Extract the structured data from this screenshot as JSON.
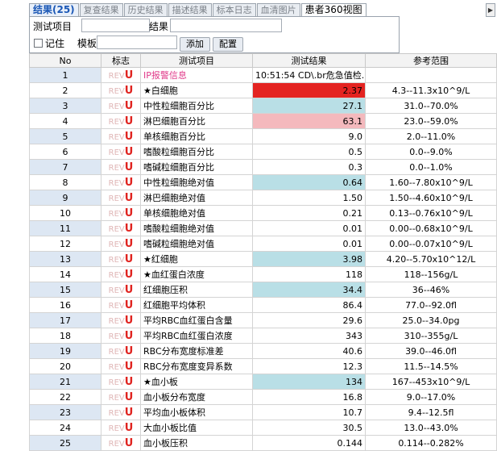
{
  "tabs": [
    {
      "label": "结果(25)",
      "active": true
    },
    {
      "label": "复查结果",
      "active": false
    },
    {
      "label": "历史结果",
      "active": false
    },
    {
      "label": "描述结果",
      "active": false
    },
    {
      "label": "标本日志",
      "active": false
    },
    {
      "label": "血清图片",
      "active": false
    },
    {
      "label": "患者360视图",
      "active": false
    }
  ],
  "filter": {
    "test_item_label": "测试项目",
    "result_label": "结果",
    "remember_label": "记住",
    "template_label": "模板",
    "add_button": "添加",
    "config_button": "配置"
  },
  "table": {
    "headers": [
      "No",
      "标志",
      "测试项目",
      "测试结果",
      "参考范围"
    ],
    "flag_rev": "REV",
    "flag_u": "U",
    "rows": [
      {
        "no": "1",
        "name": "IP报警信息",
        "result": "10:51:54 CD\\.br危急值检...",
        "ref": "",
        "hl": ""
      },
      {
        "no": "2",
        "name": "★白细胞",
        "result": "2.37",
        "ref": "4.3--11.3x10^9/L",
        "hl": "red"
      },
      {
        "no": "3",
        "name": "中性粒细胞百分比",
        "result": "27.1",
        "ref": "31.0--70.0%",
        "hl": "blue"
      },
      {
        "no": "4",
        "name": "淋巴细胞百分比",
        "result": "63.1",
        "ref": "23.0--59.0%",
        "hl": "pink"
      },
      {
        "no": "5",
        "name": "单核细胞百分比",
        "result": "9.0",
        "ref": "2.0--11.0%",
        "hl": ""
      },
      {
        "no": "6",
        "name": "嗜酸粒细胞百分比",
        "result": "0.5",
        "ref": "0.0--9.0%",
        "hl": ""
      },
      {
        "no": "7",
        "name": "嗜碱粒细胞百分比",
        "result": "0.3",
        "ref": "0.0--1.0%",
        "hl": ""
      },
      {
        "no": "8",
        "name": "中性粒细胞绝对值",
        "result": "0.64",
        "ref": "1.60--7.80x10^9/L",
        "hl": "blue"
      },
      {
        "no": "9",
        "name": "淋巴细胞绝对值",
        "result": "1.50",
        "ref": "1.50--4.60x10^9/L",
        "hl": ""
      },
      {
        "no": "10",
        "name": "单核细胞绝对值",
        "result": "0.21",
        "ref": "0.13--0.76x10^9/L",
        "hl": ""
      },
      {
        "no": "11",
        "name": "嗜酸粒细胞绝对值",
        "result": "0.01",
        "ref": "0.00--0.68x10^9/L",
        "hl": ""
      },
      {
        "no": "12",
        "name": "嗜碱粒细胞绝对值",
        "result": "0.01",
        "ref": "0.00--0.07x10^9/L",
        "hl": ""
      },
      {
        "no": "13",
        "name": "★红细胞",
        "result": "3.98",
        "ref": "4.20--5.70x10^12/L",
        "hl": "blue"
      },
      {
        "no": "14",
        "name": "★血红蛋白浓度",
        "result": "118",
        "ref": "118--156g/L",
        "hl": ""
      },
      {
        "no": "15",
        "name": "红细胞压积",
        "result": "34.4",
        "ref": "36--46%",
        "hl": "blue"
      },
      {
        "no": "16",
        "name": "红细胞平均体积",
        "result": "86.4",
        "ref": "77.0--92.0fl",
        "hl": ""
      },
      {
        "no": "17",
        "name": "平均RBC血红蛋白含量",
        "result": "29.6",
        "ref": "25.0--34.0pg",
        "hl": ""
      },
      {
        "no": "18",
        "name": "平均RBC血红蛋白浓度",
        "result": "343",
        "ref": "310--355g/L",
        "hl": ""
      },
      {
        "no": "19",
        "name": "RBC分布宽度标准差",
        "result": "40.6",
        "ref": "39.0--46.0fl",
        "hl": ""
      },
      {
        "no": "20",
        "name": "RBC分布宽度变异系数",
        "result": "12.3",
        "ref": "11.5--14.5%",
        "hl": ""
      },
      {
        "no": "21",
        "name": "★血小板",
        "result": "134",
        "ref": "167--453x10^9/L",
        "hl": "blue"
      },
      {
        "no": "22",
        "name": "血小板分布宽度",
        "result": "16.8",
        "ref": "9.0--17.0%",
        "hl": ""
      },
      {
        "no": "23",
        "name": "平均血小板体积",
        "result": "10.7",
        "ref": "9.4--12.5fl",
        "hl": ""
      },
      {
        "no": "24",
        "name": "大血小板比值",
        "result": "30.5",
        "ref": "13.0--43.0%",
        "hl": ""
      },
      {
        "no": "25",
        "name": "血小板压积",
        "result": "0.144",
        "ref": "0.114--0.282%",
        "hl": ""
      }
    ]
  }
}
